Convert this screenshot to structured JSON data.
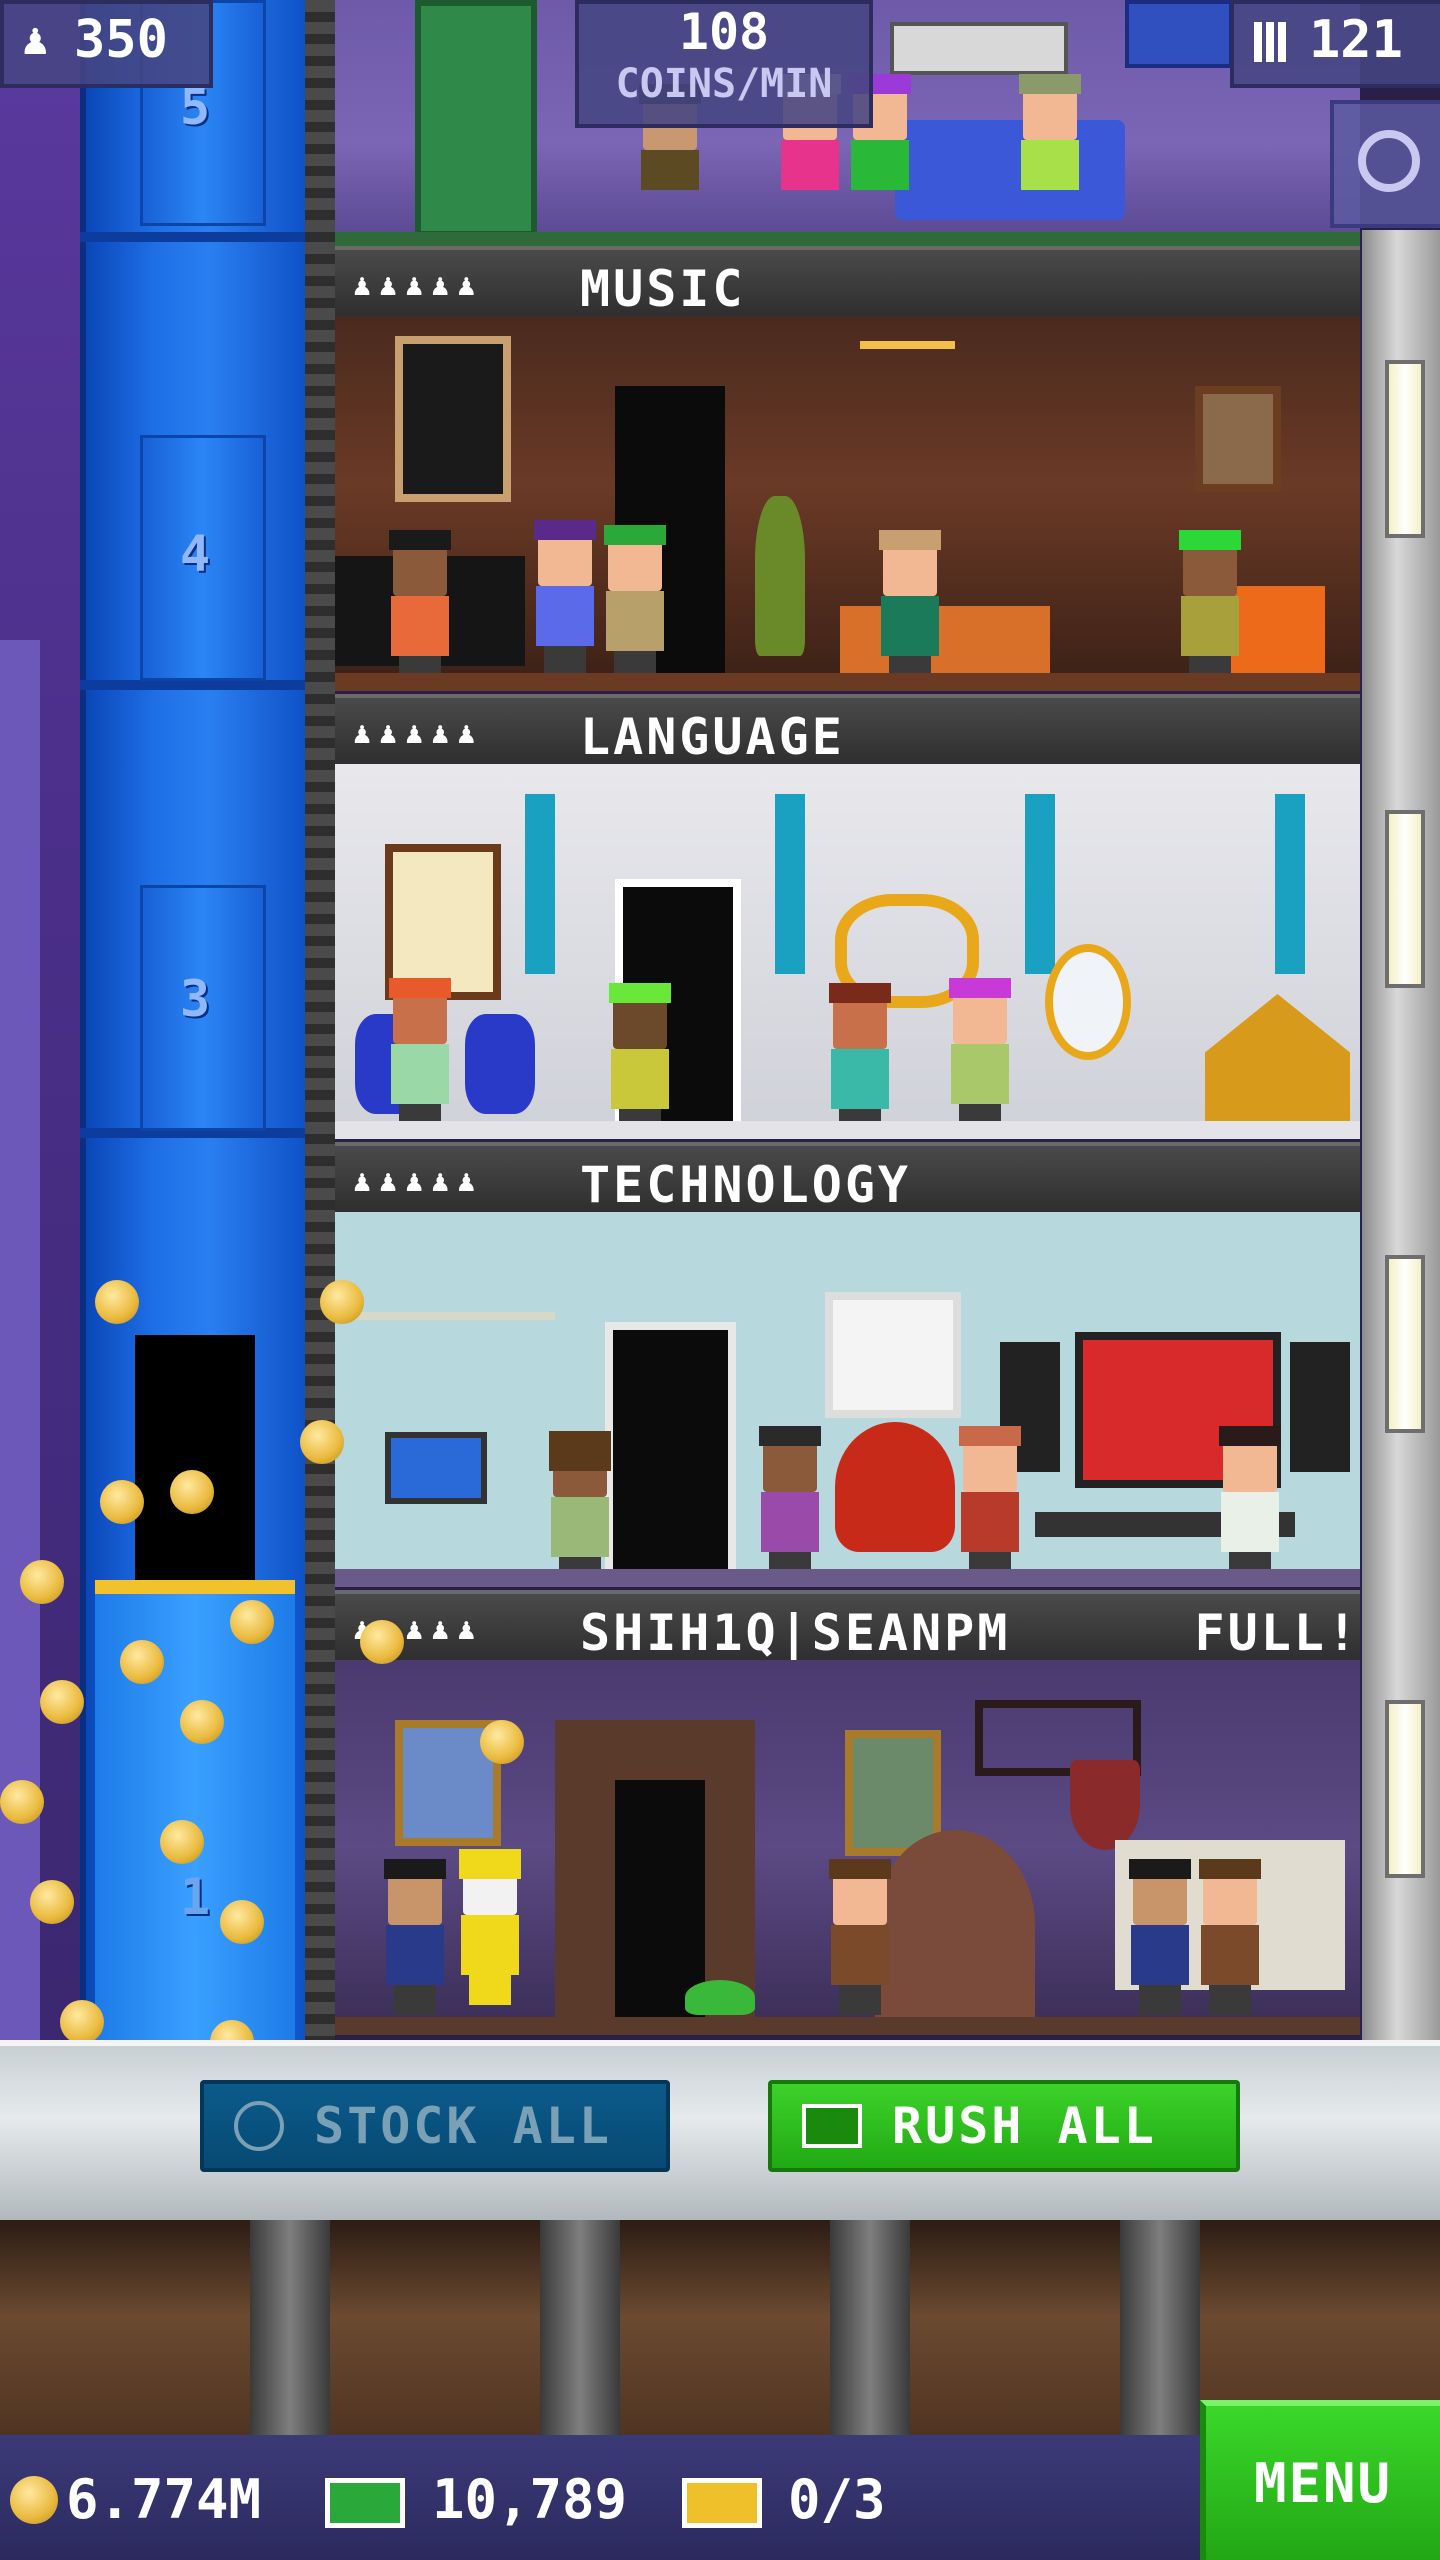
{
  "hud": {
    "population": "350",
    "coins_per_min_value": "108",
    "coins_per_min_label": "COINS/MIN",
    "floors": "121"
  },
  "elevator": {
    "floor_numbers": [
      "5",
      "4",
      "3",
      "1"
    ]
  },
  "floors": [
    {
      "name": "MUSIC",
      "status": ""
    },
    {
      "name": "LANGUAGE",
      "status": ""
    },
    {
      "name": "TECHNOLOGY",
      "status": ""
    },
    {
      "name": "SHIH1Q|SEANPM",
      "status": "FULL!"
    }
  ],
  "actions": {
    "stock_all": "STOCK ALL",
    "rush_all": "RUSH ALL"
  },
  "bottom": {
    "coins": "6.774M",
    "bux": "10,789",
    "tickets": "0/3",
    "menu": "MENU"
  },
  "colors": {
    "elevator_blue": "#1e6ee6",
    "rush_green": "#2ec11c",
    "stock_blue": "#0b5a8a",
    "coin_gold": "#e9b93c",
    "hud_purple": "#46468a"
  },
  "icons": {
    "population": "person-icon",
    "floors": "building-icon",
    "search": "magnifier-icon",
    "stock": "clock-icon",
    "rush": "bux-icon",
    "coins": "coin-icon",
    "bux": "bux-icon",
    "tickets": "ticket-icon"
  }
}
